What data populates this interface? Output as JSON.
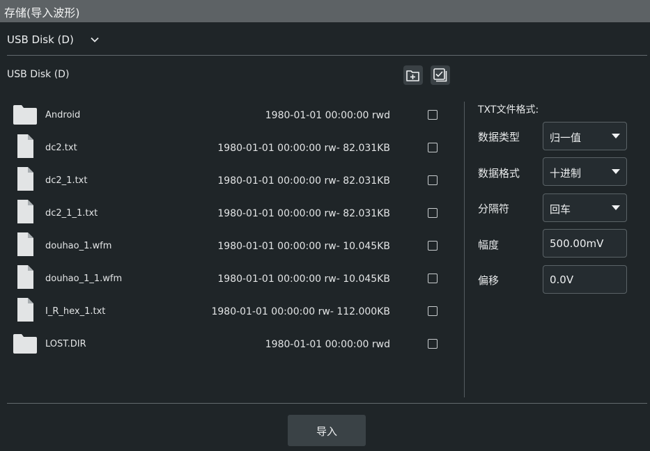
{
  "dialog": {
    "title": "存储(导入波形)"
  },
  "drive_selector": {
    "value": "USB Disk (D)"
  },
  "path": {
    "label": "USB Disk (D)"
  },
  "toolbar": {
    "new_folder_icon": "new-folder-icon",
    "select_all_icon": "select-all-icon"
  },
  "files": [
    {
      "type": "folder",
      "name": "Android",
      "meta": "1980-01-01 00:00:00 rwd"
    },
    {
      "type": "file",
      "name": "dc2.txt",
      "meta": "1980-01-01 00:00:00 rw- 82.031KB"
    },
    {
      "type": "file",
      "name": "dc2_1.txt",
      "meta": "1980-01-01 00:00:00 rw- 82.031KB"
    },
    {
      "type": "file",
      "name": "dc2_1_1.txt",
      "meta": "1980-01-01 00:00:00 rw- 82.031KB"
    },
    {
      "type": "file",
      "name": "douhao_1.wfm",
      "meta": "1980-01-01 00:00:00 rw- 10.045KB"
    },
    {
      "type": "file",
      "name": "douhao_1_1.wfm",
      "meta": "1980-01-01 00:00:00 rw- 10.045KB"
    },
    {
      "type": "file",
      "name": "I_R_hex_1.txt",
      "meta": "1980-01-01 00:00:00 rw- 112.000KB"
    },
    {
      "type": "folder",
      "name": "LOST.DIR",
      "meta": "1980-01-01 00:00:00 rwd"
    }
  ],
  "txt_format": {
    "heading": "TXT文件格式:",
    "data_type": {
      "label": "数据类型",
      "value": "归一值"
    },
    "data_format": {
      "label": "数据格式",
      "value": "十进制"
    },
    "separator": {
      "label": "分隔符",
      "value": "回车"
    },
    "amplitude": {
      "label": "幅度",
      "value": "500.00mV"
    },
    "offset": {
      "label": "偏移",
      "value": "0.0V"
    }
  },
  "actions": {
    "import_label": "导入"
  }
}
